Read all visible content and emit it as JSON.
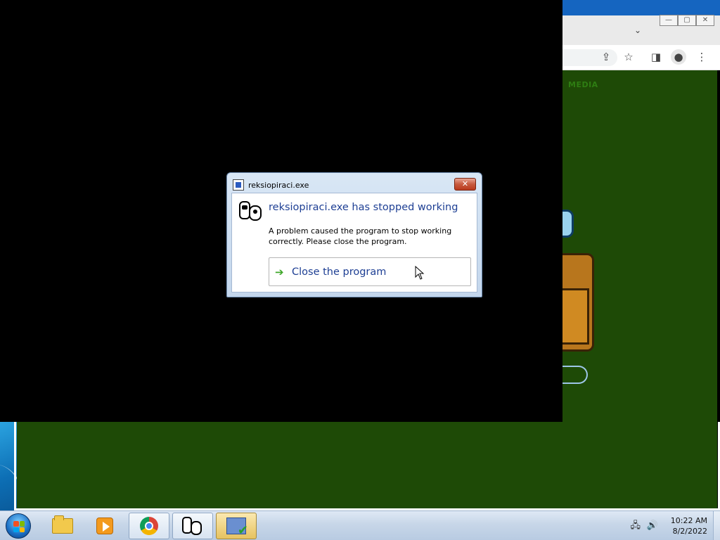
{
  "dialog": {
    "title": "reksiopiraci.exe",
    "heading": "reksiopiraci.exe has stopped working",
    "message": "A problem caused the program to stop working correctly. Please close the program.",
    "close_button_label": "Close the program",
    "close_x": "✕"
  },
  "browser": {
    "window_buttons": [
      "—",
      "▢",
      "✕"
    ],
    "tab_chevron": "⌄",
    "toolbar_icons": [
      "share-icon",
      "star-icon",
      "side-panel-icon",
      "profile-icon",
      "menu-icon"
    ],
    "content_text": "MEDIA"
  },
  "taskbar": {
    "items": [
      "start-button",
      "file-explorer",
      "media-player",
      "chrome",
      "reksiopiraci",
      "windows-error-reporting"
    ],
    "clock_time": "10:22 AM",
    "clock_date": "8/2/2022"
  },
  "colors": {
    "dialog_heading": "#1e3f94",
    "game_background": "#000000",
    "page_background": "#1e4a06",
    "chrome_titlebar": "#1565c0"
  }
}
